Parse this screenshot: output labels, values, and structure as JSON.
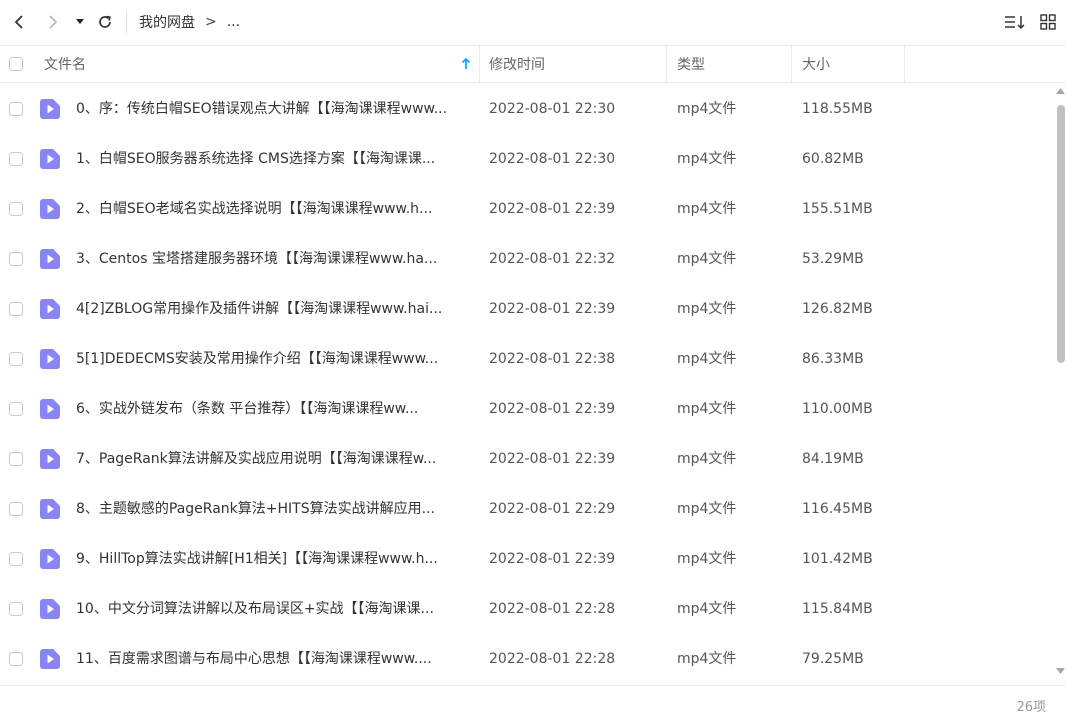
{
  "toolbar": {
    "back_icon": "chevron-left-icon",
    "forward_icon": "chevron-right-icon",
    "dropdown_icon": "caret-down-icon",
    "refresh_icon": "refresh-icon",
    "breadcrumb": {
      "root": "我的网盘",
      "separator": ">",
      "more": "..."
    },
    "sort_icon": "sort-list-icon",
    "view_icon": "grid-view-icon"
  },
  "columns": {
    "name": "文件名",
    "time": "修改时间",
    "type": "类型",
    "size": "大小"
  },
  "colors": {
    "accent": "#06a7ff",
    "file_icon": "#8a85f5"
  },
  "files": [
    {
      "name": "0、序：传统白帽SEO错误观点大讲解【【海淘课课程www...",
      "time": "2022-08-01 22:30",
      "type": "mp4文件",
      "size": "118.55MB"
    },
    {
      "name": "1、白帽SEO服务器系统选择 CMS选择方案【【海淘课课...",
      "time": "2022-08-01 22:30",
      "type": "mp4文件",
      "size": "60.82MB"
    },
    {
      "name": "2、白帽SEO老域名实战选择说明【【海淘课课程www.h...",
      "time": "2022-08-01 22:39",
      "type": "mp4文件",
      "size": "155.51MB"
    },
    {
      "name": "3、Centos 宝塔搭建服务器环境【【海淘课课程www.ha...",
      "time": "2022-08-01 22:32",
      "type": "mp4文件",
      "size": "53.29MB"
    },
    {
      "name": "4[2]ZBLOG常用操作及插件讲解【【海淘课课程www.hai...",
      "time": "2022-08-01 22:39",
      "type": "mp4文件",
      "size": "126.82MB"
    },
    {
      "name": "5[1]DEDECMS安装及常用操作介绍【【海淘课课程www...",
      "time": "2022-08-01 22:38",
      "type": "mp4文件",
      "size": "86.33MB"
    },
    {
      "name": "6、实战外链发布（条数 平台推荐）【【海淘课课程ww...",
      "time": "2022-08-01 22:39",
      "type": "mp4文件",
      "size": "110.00MB"
    },
    {
      "name": "7、PageRank算法讲解及实战应用说明【【海淘课课程w...",
      "time": "2022-08-01 22:39",
      "type": "mp4文件",
      "size": "84.19MB"
    },
    {
      "name": "8、主题敏感的PageRank算法+HITS算法实战讲解应用...",
      "time": "2022-08-01 22:29",
      "type": "mp4文件",
      "size": "116.45MB"
    },
    {
      "name": "9、HillTop算法实战讲解[H1相关]【【海淘课课程www.h...",
      "time": "2022-08-01 22:39",
      "type": "mp4文件",
      "size": "101.42MB"
    },
    {
      "name": "10、中文分词算法讲解以及布局误区+实战【【海淘课课...",
      "time": "2022-08-01 22:28",
      "type": "mp4文件",
      "size": "115.84MB"
    },
    {
      "name": "11、百度需求图谱与布局中心思想【【海淘课课程www....",
      "time": "2022-08-01 22:28",
      "type": "mp4文件",
      "size": "79.25MB"
    }
  ],
  "footer": {
    "count": "26项"
  }
}
